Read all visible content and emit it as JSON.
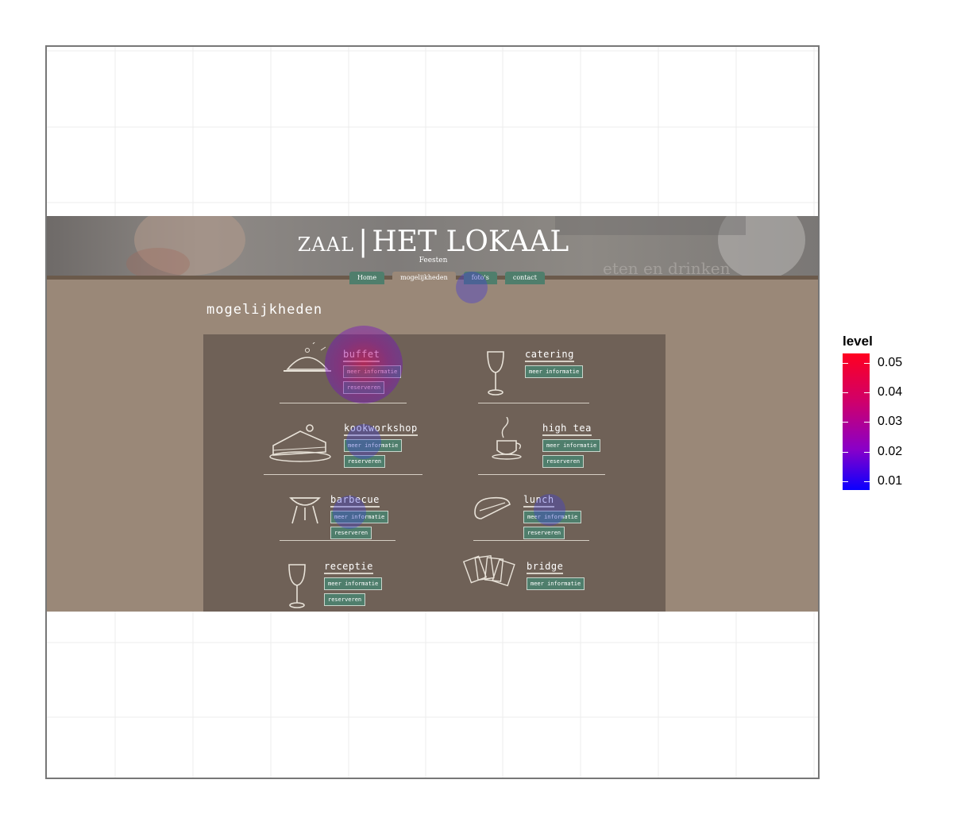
{
  "brand": {
    "prefix": "ZAAL",
    "separator": "|",
    "name": "HET LOKAAL",
    "subtitle": "Feesten"
  },
  "banner": {
    "background_text": "eten en drinken"
  },
  "nav": [
    {
      "label": "Home"
    },
    {
      "label": "mogelijkheden"
    },
    {
      "label": "foto's"
    },
    {
      "label": "contact"
    }
  ],
  "page": {
    "heading": "mogelijkheden"
  },
  "items": [
    {
      "title": "buffet",
      "icon": "cloche-icon",
      "more": "meer informatie",
      "reserve": "reserveren"
    },
    {
      "title": "catering",
      "icon": "wine-glass-icon",
      "more": "meer informatie"
    },
    {
      "title": "kookworkshop",
      "icon": "cake-icon",
      "more": "meer informatie",
      "reserve": "reserveren"
    },
    {
      "title": "high tea",
      "icon": "teacup-icon",
      "more": "meer informatie",
      "reserve": "reserveren"
    },
    {
      "title": "barbecue",
      "icon": "grill-icon",
      "more": "meer informatie",
      "reserve": "reserveren"
    },
    {
      "title": "lunch",
      "icon": "sandwich-icon",
      "more": "meer informatie",
      "reserve": "reserveren"
    },
    {
      "title": "receptie",
      "icon": "wine-glass-icon",
      "more": "meer informatie",
      "reserve": "reserveren"
    },
    {
      "title": "bridge",
      "icon": "playing-cards-icon",
      "more": "meer informatie"
    }
  ],
  "legend": {
    "title": "level",
    "ticks": [
      "0.05",
      "0.04",
      "0.03",
      "0.02",
      "0.01"
    ]
  },
  "colors": {
    "accent_green": "#4f7e6c",
    "page_brown": "#9a8878",
    "board_brown": "#6f6157",
    "heat_high": "#ff0020",
    "heat_low": "#0a00ff"
  }
}
